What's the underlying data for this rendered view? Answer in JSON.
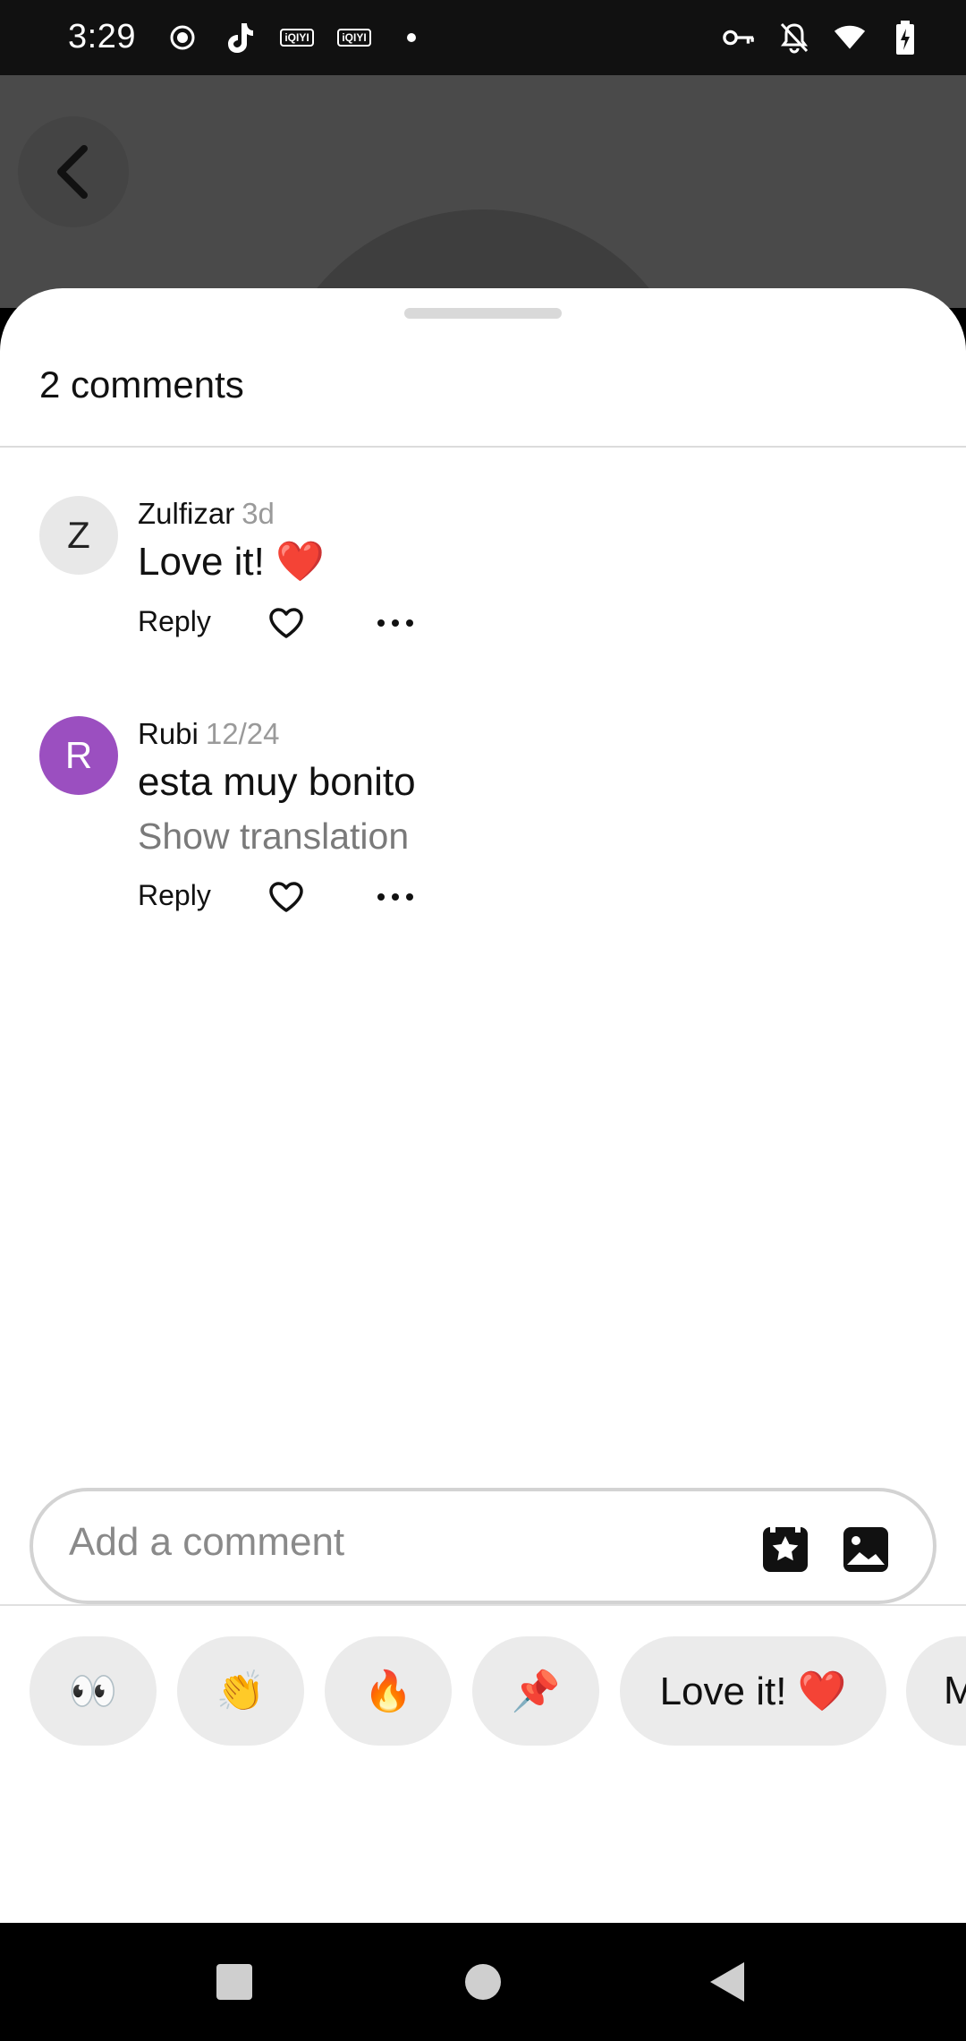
{
  "status_bar": {
    "time": "3:29",
    "left_icons": [
      "record-icon",
      "tiktok-icon",
      "iqiyi-icon",
      "iqiyi-icon",
      "dot-icon"
    ],
    "iqiyi_label": "iQIYI",
    "right_icons": [
      "vpn-key-icon",
      "bell-off-icon",
      "wifi-icon",
      "battery-charging-icon"
    ]
  },
  "sheet": {
    "title": "2 comments"
  },
  "comments": [
    {
      "avatar_letter": "Z",
      "user": "Zulfizar",
      "time": "3d",
      "text": "Love it! ❤️",
      "reply_label": "Reply"
    },
    {
      "avatar_letter": "R",
      "user": "Rubi",
      "time": "12/24",
      "text": "esta muy bonito",
      "translate_label": "Show translation",
      "reply_label": "Reply"
    }
  ],
  "quick_replies": [
    "👀",
    "👏",
    "🔥",
    "📌",
    "Love it! ❤️",
    "M"
  ],
  "composer": {
    "placeholder": "Add a comment"
  },
  "colors": {
    "avatar_r": "#9b4fc0",
    "sheet_bg": "#ffffff",
    "chip_bg": "#ebebeb"
  }
}
